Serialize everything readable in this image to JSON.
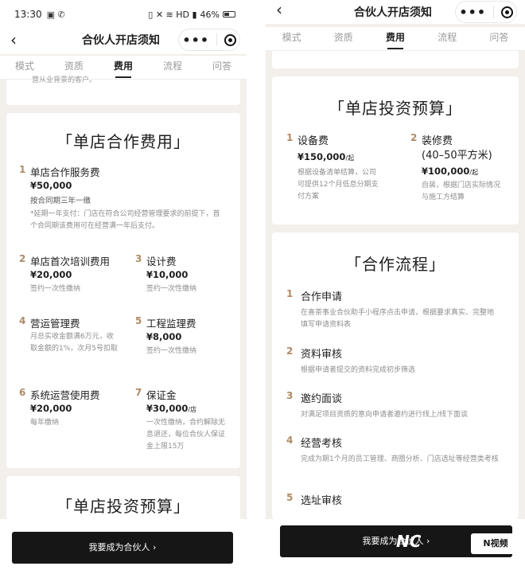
{
  "left": {
    "status": {
      "time": "13:30",
      "signal_icons": "▣ ✆",
      "right_icons": "▯ ✕ ≋ HD ▮",
      "battery": "46%"
    },
    "title": "合伙人开店须知",
    "tabs": [
      "模式",
      "资质",
      "费用",
      "流程",
      "问答"
    ],
    "top_fragment": "营从业背景的客户。",
    "fee_card": {
      "title": "「单店合作费用」",
      "items": [
        {
          "num": "1",
          "name": "单店合作服务费",
          "price": "¥50,000",
          "desc": "按合同期三年一缴"
        },
        {
          "num": "2",
          "name": "单店首次培训费用",
          "price": "¥20,000",
          "desc": "签约一次性缴纳"
        },
        {
          "num": "3",
          "name": "设计费",
          "price": "¥10,000",
          "desc": "签约一次性缴纳"
        },
        {
          "num": "4",
          "name": "营运管理费",
          "price": "",
          "desc": "月总实收金额满6万元，收取金额的1%，次月5号扣取"
        },
        {
          "num": "5",
          "name": "工程监理费",
          "price": "¥8,000",
          "desc": "签约一次性缴纳"
        },
        {
          "num": "6",
          "name": "系统运营使用费",
          "price": "¥20,000",
          "desc": "每年缴纳"
        },
        {
          "num": "7",
          "name": "保证金",
          "price": "¥30,000",
          "price_unit": "/店",
          "desc": "一次性缴纳，合约解除无息退还，每位合伙人保证金上限15万"
        }
      ],
      "note": "*延期一年支付：门店在符合公司经营管理要求的前提下，首个合同期该费用可在经营满一年后支付。"
    },
    "invest_title": "「单店投资预算」",
    "cta": "我要成为合伙人 ›"
  },
  "right": {
    "title": "合伙人开店须知",
    "tabs": [
      "模式",
      "资质",
      "费用",
      "流程",
      "问答"
    ],
    "invest_card": {
      "title": "「单店投资预算」",
      "items": [
        {
          "num": "1",
          "name": "设备费",
          "price": "¥150,000",
          "price_unit": "/起",
          "desc": "根据设备清单结算，公司可提供12个月低息分期支付方案"
        },
        {
          "num": "2",
          "name": "装修费",
          "name2": "(40–50平方米)",
          "price": "¥100,000",
          "price_unit": "/起",
          "desc": "自装，根据门店实际情况与施工方结算"
        }
      ]
    },
    "flow_card": {
      "title": "「合作流程」",
      "steps": [
        {
          "num": "1",
          "name": "合作申请",
          "desc": "在喜茶事业合伙助手小程序点击申请，根据要求真实、完整地填写申请资料表"
        },
        {
          "num": "2",
          "name": "资料审核",
          "desc": "根据申请者提交的资料完成初步筛选"
        },
        {
          "num": "3",
          "name": "邀约面谈",
          "desc": "对满足项目资质的意向申请者邀约进行线上/线下面谈"
        },
        {
          "num": "4",
          "name": "经营考核",
          "desc": "完成为期1个月的员工管理、商圈分析、门店选址等经营类考核"
        },
        {
          "num": "5",
          "name": "选址审核",
          "desc": ""
        }
      ]
    },
    "cta": "我要成为合伙人 ›",
    "watermark_a": "NC",
    "watermark_b": "N视频"
  }
}
